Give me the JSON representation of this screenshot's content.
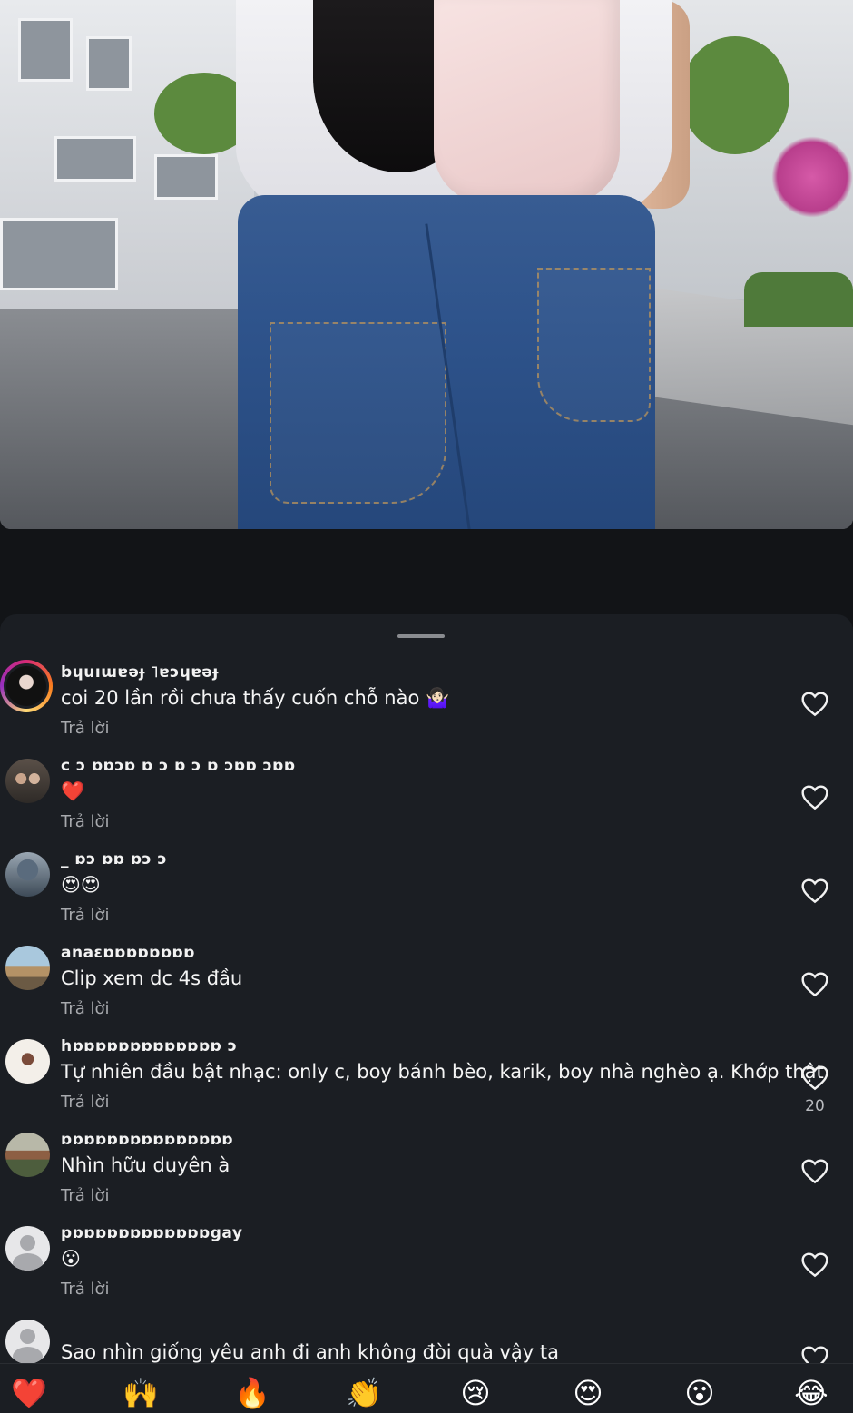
{
  "comments": [
    {
      "username": "bɥuıɯɐǝɟ ˥ɐɔɥɐǝɟ",
      "text": "coi 20 lần rồi chưa thấy cuốn chỗ nào 🤷🏻‍♀️",
      "reply": "Trả lời",
      "likes": ""
    },
    {
      "username": "c ɔ ɒɒɔɒ ɒ ɔ ɒ ɔ ɒ ɔɒɒ ɔɒɒ",
      "text": "❤️",
      "reply": "Trả lời",
      "likes": ""
    },
    {
      "username": "_ ɒɔ ɒɒ ɒɔ ɔ",
      "text": "😍😍",
      "reply": "Trả lời",
      "likes": ""
    },
    {
      "username": "anaɛɒɒɒɒɒɒɒɒ",
      "text": "Clip xem dc 4s đầu",
      "reply": "Trả lời",
      "likes": ""
    },
    {
      "username": "hɒɒɒɒɒɒɒɒɒɒɒɒɒ ɔ",
      "text": "Tự nhiên đầu bật nhạc: only c, boy bánh bèo, karik, boy nhà nghèo ạ. Khớp thật",
      "reply": "Trả lời",
      "likes": "20"
    },
    {
      "username": "ɒɒɒɒɒɒɒɒɒɒɒɒɒɒɒ",
      "text": "Nhìn hữu duyên à",
      "reply": "Trả lời",
      "likes": ""
    },
    {
      "username": "pɒɒɒɒɒɒɒɒɒɒɒɒgay",
      "text": "😮",
      "reply": "Trả lời",
      "likes": ""
    },
    {
      "username": "",
      "text": "Sao nhìn giống yêu anh đi anh không đòi quà vậy ta",
      "reply": "",
      "likes": ""
    }
  ],
  "reactions": [
    "❤️",
    "🙌",
    "🔥",
    "👏",
    "😢",
    "😍",
    "😮",
    "😂"
  ],
  "colors": {
    "background": "#121417",
    "sheet": "#1b1e23",
    "secondary_text": "#a7a9ad"
  }
}
